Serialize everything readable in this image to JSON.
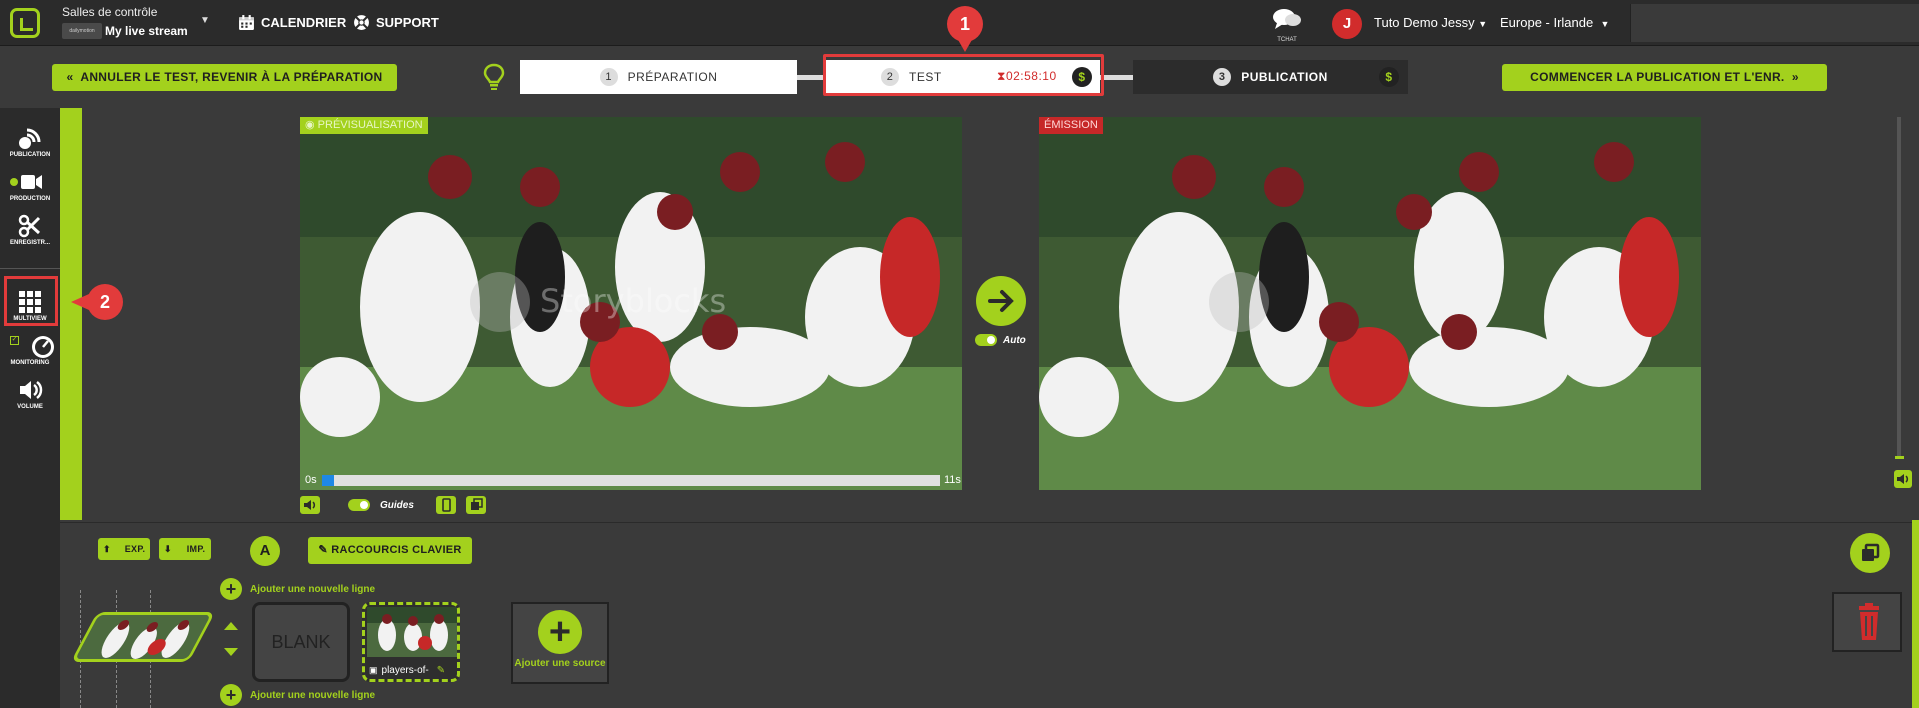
{
  "header": {
    "brand_title": "Salles de contrôle",
    "brand_badge": "dailymotion",
    "stream_name": "My live stream",
    "nav": [
      "CALENDRIER",
      "SUPPORT"
    ],
    "chat_label": "TCHAT",
    "avatar_letter": "J",
    "user_name": "Tuto Demo Jessy",
    "region": "Europe - Irlande"
  },
  "steps": {
    "cancel_label": "ANNULER LE TEST, REVENIR À LA PRÉPARATION",
    "start_label": "COMMENCER LA PUBLICATION ET L'ENR.",
    "items": [
      {
        "num": "1",
        "label": "PRÉPARATION"
      },
      {
        "num": "2",
        "label": "TEST",
        "timer": "02:58:10"
      },
      {
        "num": "3",
        "label": "PUBLICATION"
      }
    ],
    "currency": "$"
  },
  "markers": [
    "1",
    "2"
  ],
  "sidebar": {
    "items": [
      "PUBLICATION",
      "PRODUCTION",
      "ENREGISTR...",
      "MULTIVIEW",
      "MONITORING",
      "VOLUME"
    ]
  },
  "preview": {
    "tag": "PRÉVISUALISATION",
    "time_start": "0s",
    "time_end": "11s",
    "progress": 0.02,
    "guides_label": "Guides",
    "watermark": "Storyblocks"
  },
  "emission": {
    "tag": "ÉMISSION"
  },
  "take": {
    "auto_label": "Auto"
  },
  "bottom": {
    "exp_label": "EXP.",
    "imp_label": "IMP.",
    "a_label": "A",
    "shortcuts_label": "RACCOURCIS CLAVIER",
    "add_line_label": "Ajouter une nouvelle ligne",
    "blank_label": "BLANK",
    "source_label": "players-of-",
    "add_source_label": "Ajouter une source"
  },
  "colors": {
    "accent": "#a3d11d",
    "alert": "#e23b3b",
    "emission": "#c62828",
    "progress": "#1e88e5"
  }
}
